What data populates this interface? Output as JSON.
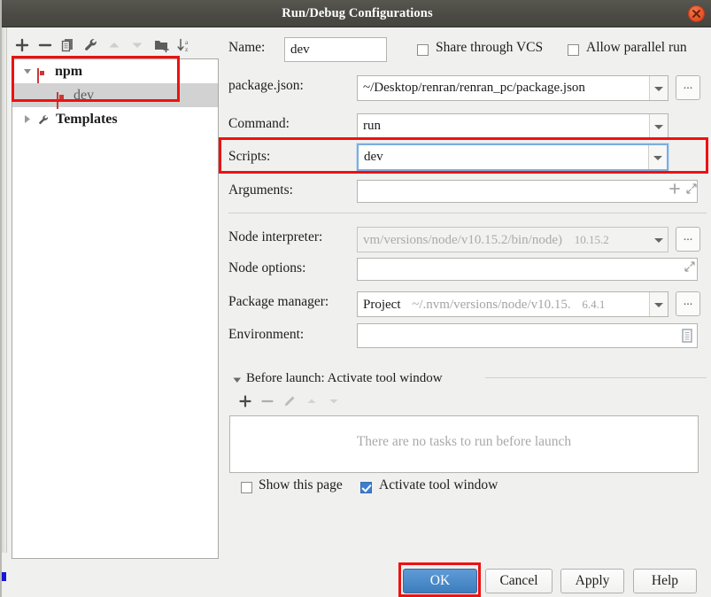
{
  "window": {
    "title": "Run/Debug Configurations",
    "close_icon": "close-icon"
  },
  "toolbar": {
    "items": [
      {
        "name": "add-configuration-button",
        "glyph": "+",
        "enabled": true
      },
      {
        "name": "remove-configuration-button",
        "glyph": "−",
        "enabled": true
      },
      {
        "name": "copy-configuration-button",
        "glyph": "copy-icon",
        "enabled": true
      },
      {
        "name": "edit-templates-button",
        "glyph": "wrench-icon",
        "enabled": true
      },
      {
        "name": "move-up-button",
        "glyph": "triangle-up-icon",
        "enabled": false
      },
      {
        "name": "move-down-button",
        "glyph": "triangle-down-icon",
        "enabled": false
      },
      {
        "name": "move-into-folder-button",
        "glyph": "folder-add-icon",
        "enabled": true
      },
      {
        "name": "sort-alphabetically-button",
        "glyph": "sort-az-icon",
        "enabled": true
      }
    ]
  },
  "tree": {
    "nodes": [
      {
        "label": "npm",
        "icon": "npm-icon",
        "expanded": true,
        "depth": 0,
        "selected": false,
        "bold": true
      },
      {
        "label": "dev",
        "icon": "npm-icon",
        "depth": 1,
        "selected": true,
        "bold": false
      },
      {
        "label": "Templates",
        "icon": "wrench-icon",
        "expanded": false,
        "depth": 0,
        "selected": false,
        "bold": true
      }
    ]
  },
  "form": {
    "name_label": "Name:",
    "name_value": "dev",
    "share_vcs_label": "Share through VCS",
    "share_vcs_checked": false,
    "allow_parallel_label": "Allow parallel run",
    "allow_parallel_checked": false,
    "package_json_label": "package.json:",
    "package_json_value": "~/Desktop/renran/renran_pc/package.json",
    "package_json_browse": "...",
    "command_label": "Command:",
    "command_value": "run",
    "scripts_label": "Scripts:",
    "scripts_value": "dev",
    "arguments_label": "Arguments:",
    "arguments_value": "",
    "node_interpreter_label": "Node interpreter:",
    "node_interpreter_value": "vm/versions/node/v10.15.2/bin/node)",
    "node_interpreter_version": "10.15.2",
    "node_interpreter_browse": "...",
    "node_options_label": "Node options:",
    "node_options_value": "",
    "package_manager_label": "Package manager:",
    "package_manager_value": "Project",
    "package_manager_path": "~/.nvm/versions/node/v10.15.",
    "package_manager_version": "6.4.1",
    "package_manager_browse": "...",
    "environment_label": "Environment:",
    "environment_value": ""
  },
  "before_launch": {
    "header": "Before launch: Activate tool window",
    "empty_text": "There are no tasks to run before launch",
    "tools": [
      {
        "name": "add-task-button",
        "glyph": "+",
        "enabled": true
      },
      {
        "name": "remove-task-button",
        "glyph": "−",
        "enabled": false
      },
      {
        "name": "edit-task-button",
        "glyph": "pencil-icon",
        "enabled": false
      },
      {
        "name": "task-move-up-button",
        "glyph": "triangle-up-icon",
        "enabled": false
      },
      {
        "name": "task-move-down-button",
        "glyph": "triangle-down-icon",
        "enabled": false
      }
    ],
    "show_page_label": "Show this page",
    "show_page_checked": false,
    "activate_tool_window_label": "Activate tool window",
    "activate_tool_window_checked": true
  },
  "buttons": {
    "ok": "OK",
    "cancel": "Cancel",
    "apply": "Apply",
    "help": "Help"
  },
  "colors": {
    "titlebar": "#4b4a44",
    "close": "#e8552b",
    "accent": "#3d7dbd",
    "annotation": "#ee1111",
    "npm_red": "#cb3837",
    "selection": "#d2d2d2"
  }
}
